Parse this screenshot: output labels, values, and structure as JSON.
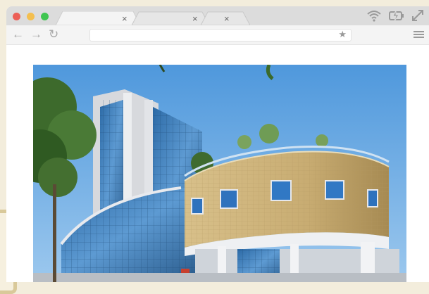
{
  "browser": {
    "tabs": [
      {
        "title": "",
        "close_label": "×"
      },
      {
        "title": "",
        "close_label": "×"
      },
      {
        "title": "",
        "close_label": "×"
      }
    ],
    "nav": {
      "back": "←",
      "forward": "→",
      "reload": "↻"
    },
    "url": {
      "value": "",
      "bookmark_icon": "star-icon"
    },
    "system_icons": [
      "wifi-icon",
      "battery-charging-icon",
      "resize-icon"
    ],
    "traffic_lights": {
      "close": "#ec5f57",
      "minimize": "#f4bf4f",
      "zoom": "#3fc550"
    }
  },
  "content": {
    "image": {
      "subject": "modern-building-photo",
      "colors": {
        "sky": "#64a8e0",
        "brick": "#c8ac72",
        "glass": "#3f7fb8"
      }
    }
  }
}
